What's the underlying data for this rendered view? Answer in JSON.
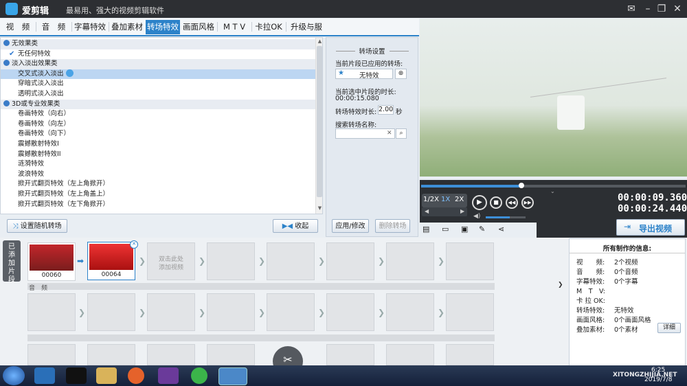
{
  "app": {
    "name": "爱剪辑",
    "slogan": "最易用、强大的视频剪辑软件"
  },
  "window_controls": [
    "mail-icon",
    "minimize",
    "restore",
    "close"
  ],
  "tabs": [
    {
      "label": "视　频"
    },
    {
      "label": "音　频"
    },
    {
      "label": "字幕特效"
    },
    {
      "label": "叠加素材"
    },
    {
      "label": "转场特效",
      "active": true
    },
    {
      "label": "画面风格"
    },
    {
      "label": "M T V"
    },
    {
      "label": "卡拉OK"
    },
    {
      "label": "升级与服务"
    }
  ],
  "effects": [
    {
      "type": "cat",
      "label": "无效果类"
    },
    {
      "type": "item",
      "label": "无任何特效",
      "checked": true
    },
    {
      "type": "cat",
      "label": "淡入淡出效果类"
    },
    {
      "type": "item",
      "label": "交叉式淡入淡出",
      "selected": true
    },
    {
      "type": "item",
      "label": "穿暗式淡入淡出"
    },
    {
      "type": "item",
      "label": "透明式淡入淡出"
    },
    {
      "type": "cat",
      "label": "3D或专业效果类"
    },
    {
      "type": "item",
      "label": "卷画特效（向右）"
    },
    {
      "type": "item",
      "label": "卷画特效（向左）"
    },
    {
      "type": "item",
      "label": "卷画特效（向下）"
    },
    {
      "type": "item",
      "label": "震撼散射特效I"
    },
    {
      "type": "item",
      "label": "震撼散射特效II"
    },
    {
      "type": "item",
      "label": "涟漪特效"
    },
    {
      "type": "item",
      "label": "波浪特效"
    },
    {
      "type": "item",
      "label": "掀开式翻页特效（左上角掀开）"
    },
    {
      "type": "item",
      "label": "掀开式翻页特效（左上角盖上）"
    },
    {
      "type": "item",
      "label": "掀开式翻页特效（左下角掀开）"
    }
  ],
  "list_buttons": {
    "random": "设置随机转场",
    "collect": "收起"
  },
  "settings": {
    "title": "转场设置",
    "applied_label": "当前片段已应用的转场:",
    "applied_value": "无特效",
    "duration_label": "当前选中片段的时长:",
    "duration_value": "00:00:15.080",
    "effect_time_label": "转场特效时长:",
    "effect_time_value": "2.00",
    "effect_time_unit": "秒",
    "search_label": "搜索转场名称:",
    "search_value": "",
    "apply_button": "应用/修改",
    "delete_button": "删除转场"
  },
  "player": {
    "speeds": [
      "1/2X",
      "1X",
      "2X"
    ],
    "active_speed": "1X",
    "current_time": "00:00:09.360",
    "total_time": "00:00:24.440",
    "progress": 0.38,
    "volume": 0.6,
    "export_button": "导出视频"
  },
  "timeline": {
    "side_tab": "已添加片段",
    "clips": [
      {
        "label": "00060"
      },
      {
        "label": "00064"
      }
    ],
    "add_hint_1": "双击此处",
    "add_hint_2": "添加视频",
    "audio_label": "音　频"
  },
  "info": {
    "title": "所有制作的信息:",
    "rows": [
      {
        "k": "视　　频:",
        "v": "2个视频"
      },
      {
        "k": "音　　频:",
        "v": "0个音频"
      },
      {
        "k": "字幕特效:",
        "v": "0个字幕"
      },
      {
        "k": "M　T　V:",
        "v": ""
      },
      {
        "k": "卡 拉 OK:",
        "v": ""
      },
      {
        "k": "转场特效:",
        "v": "无特效"
      },
      {
        "k": "画面风格:",
        "v": "0个画面风格"
      },
      {
        "k": "叠加素材:",
        "v": "0个素材"
      }
    ],
    "detail_button": "详细"
  },
  "taskbar": {
    "time": "6:25",
    "date": "2019/7/8",
    "watermark": "XITONGZHIJIA.NET"
  }
}
